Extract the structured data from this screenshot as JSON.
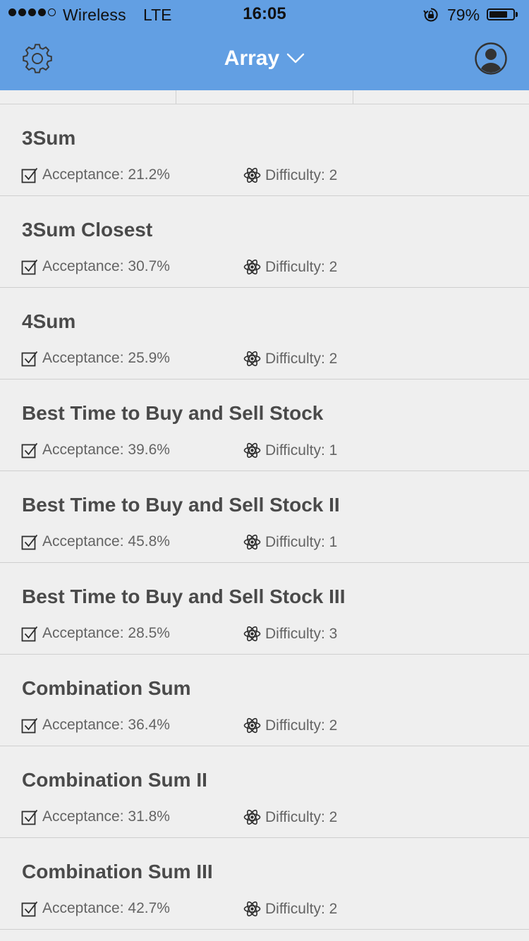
{
  "status_bar": {
    "carrier": "Wireless",
    "network": "LTE",
    "time": "16:05",
    "battery_percent": "79%",
    "battery_level": 0.79,
    "signal_bars_filled": 4,
    "signal_bars_total": 5
  },
  "nav": {
    "title": "Array",
    "left_icon": "gear-icon",
    "right_icon": "profile-icon",
    "title_icon": "chevron-down-icon",
    "background": "#629fe3"
  },
  "problems": [
    {
      "title": "3Sum",
      "acceptance": "Acceptance: 21.2%",
      "difficulty": "Difficulty: 2"
    },
    {
      "title": "3Sum Closest",
      "acceptance": "Acceptance: 30.7%",
      "difficulty": "Difficulty: 2"
    },
    {
      "title": "4Sum",
      "acceptance": "Acceptance: 25.9%",
      "difficulty": "Difficulty: 2"
    },
    {
      "title": "Best Time to Buy and Sell Stock",
      "acceptance": "Acceptance: 39.6%",
      "difficulty": "Difficulty: 1"
    },
    {
      "title": "Best Time to Buy and Sell Stock II",
      "acceptance": "Acceptance: 45.8%",
      "difficulty": "Difficulty: 1"
    },
    {
      "title": "Best Time to Buy and Sell Stock III",
      "acceptance": "Acceptance: 28.5%",
      "difficulty": "Difficulty: 3"
    },
    {
      "title": "Combination Sum",
      "acceptance": "Acceptance: 36.4%",
      "difficulty": "Difficulty: 2"
    },
    {
      "title": "Combination Sum II",
      "acceptance": "Acceptance: 31.8%",
      "difficulty": "Difficulty: 2"
    },
    {
      "title": "Combination Sum III",
      "acceptance": "Acceptance: 42.7%",
      "difficulty": "Difficulty: 2"
    }
  ]
}
